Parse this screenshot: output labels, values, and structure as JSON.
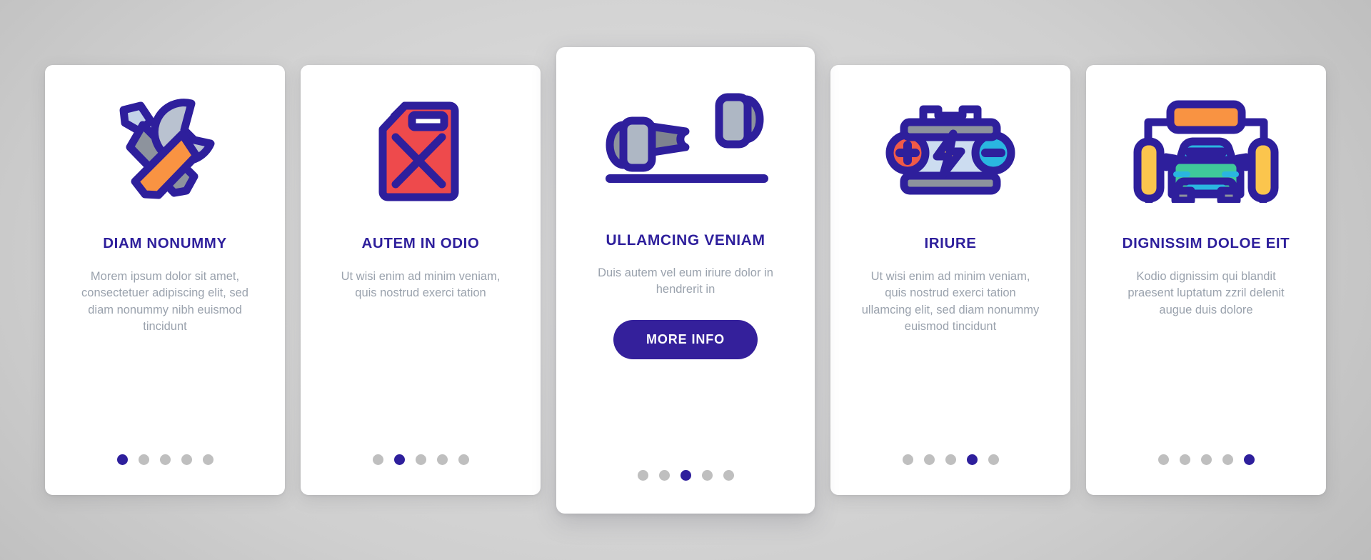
{
  "theme": {
    "background": "#d4d4d4",
    "card_background": "#ffffff",
    "accent": "#2e1f9c",
    "button_background": "#34209b",
    "body_text": "#9aa2ad",
    "dot_inactive": "#bfbfbf",
    "icon_outline": "#2e1f9c"
  },
  "cards": [
    {
      "icon": "screwdriver-wrench-icon",
      "title": "DIAM NONUMMY",
      "body": "Morem ipsum dolor sit amet, consectetuer adipiscing elit, sed diam nonummy nibh euismod tincidunt",
      "dots_total": 5,
      "dots_active": 1
    },
    {
      "icon": "fuel-can-icon",
      "title": "AUTEM IN ODIO",
      "body": "Ut wisi enim ad minim veniam, quis nostrud exerci tation",
      "dots_total": 5,
      "dots_active": 2
    },
    {
      "icon": "wheel-alignment-icon",
      "title": "ULLAMCING VENIAM",
      "body": "Duis autem vel eum iriure dolor in hendrerit in",
      "button_label": "MORE INFO",
      "dots_total": 5,
      "dots_active": 3
    },
    {
      "icon": "car-battery-icon",
      "title": "IRIURE",
      "body": "Ut wisi enim ad minim veniam, quis nostrud exerci tation ullamcing elit, sed diam nonummy euismod tincidunt",
      "dots_total": 5,
      "dots_active": 4
    },
    {
      "icon": "car-wash-icon",
      "title": "DIGNISSIM DOLOE EIT",
      "body": "Kodio dignissim qui blandit praesent luptatum zzril delenit augue duis dolore",
      "dots_total": 5,
      "dots_active": 5
    }
  ]
}
